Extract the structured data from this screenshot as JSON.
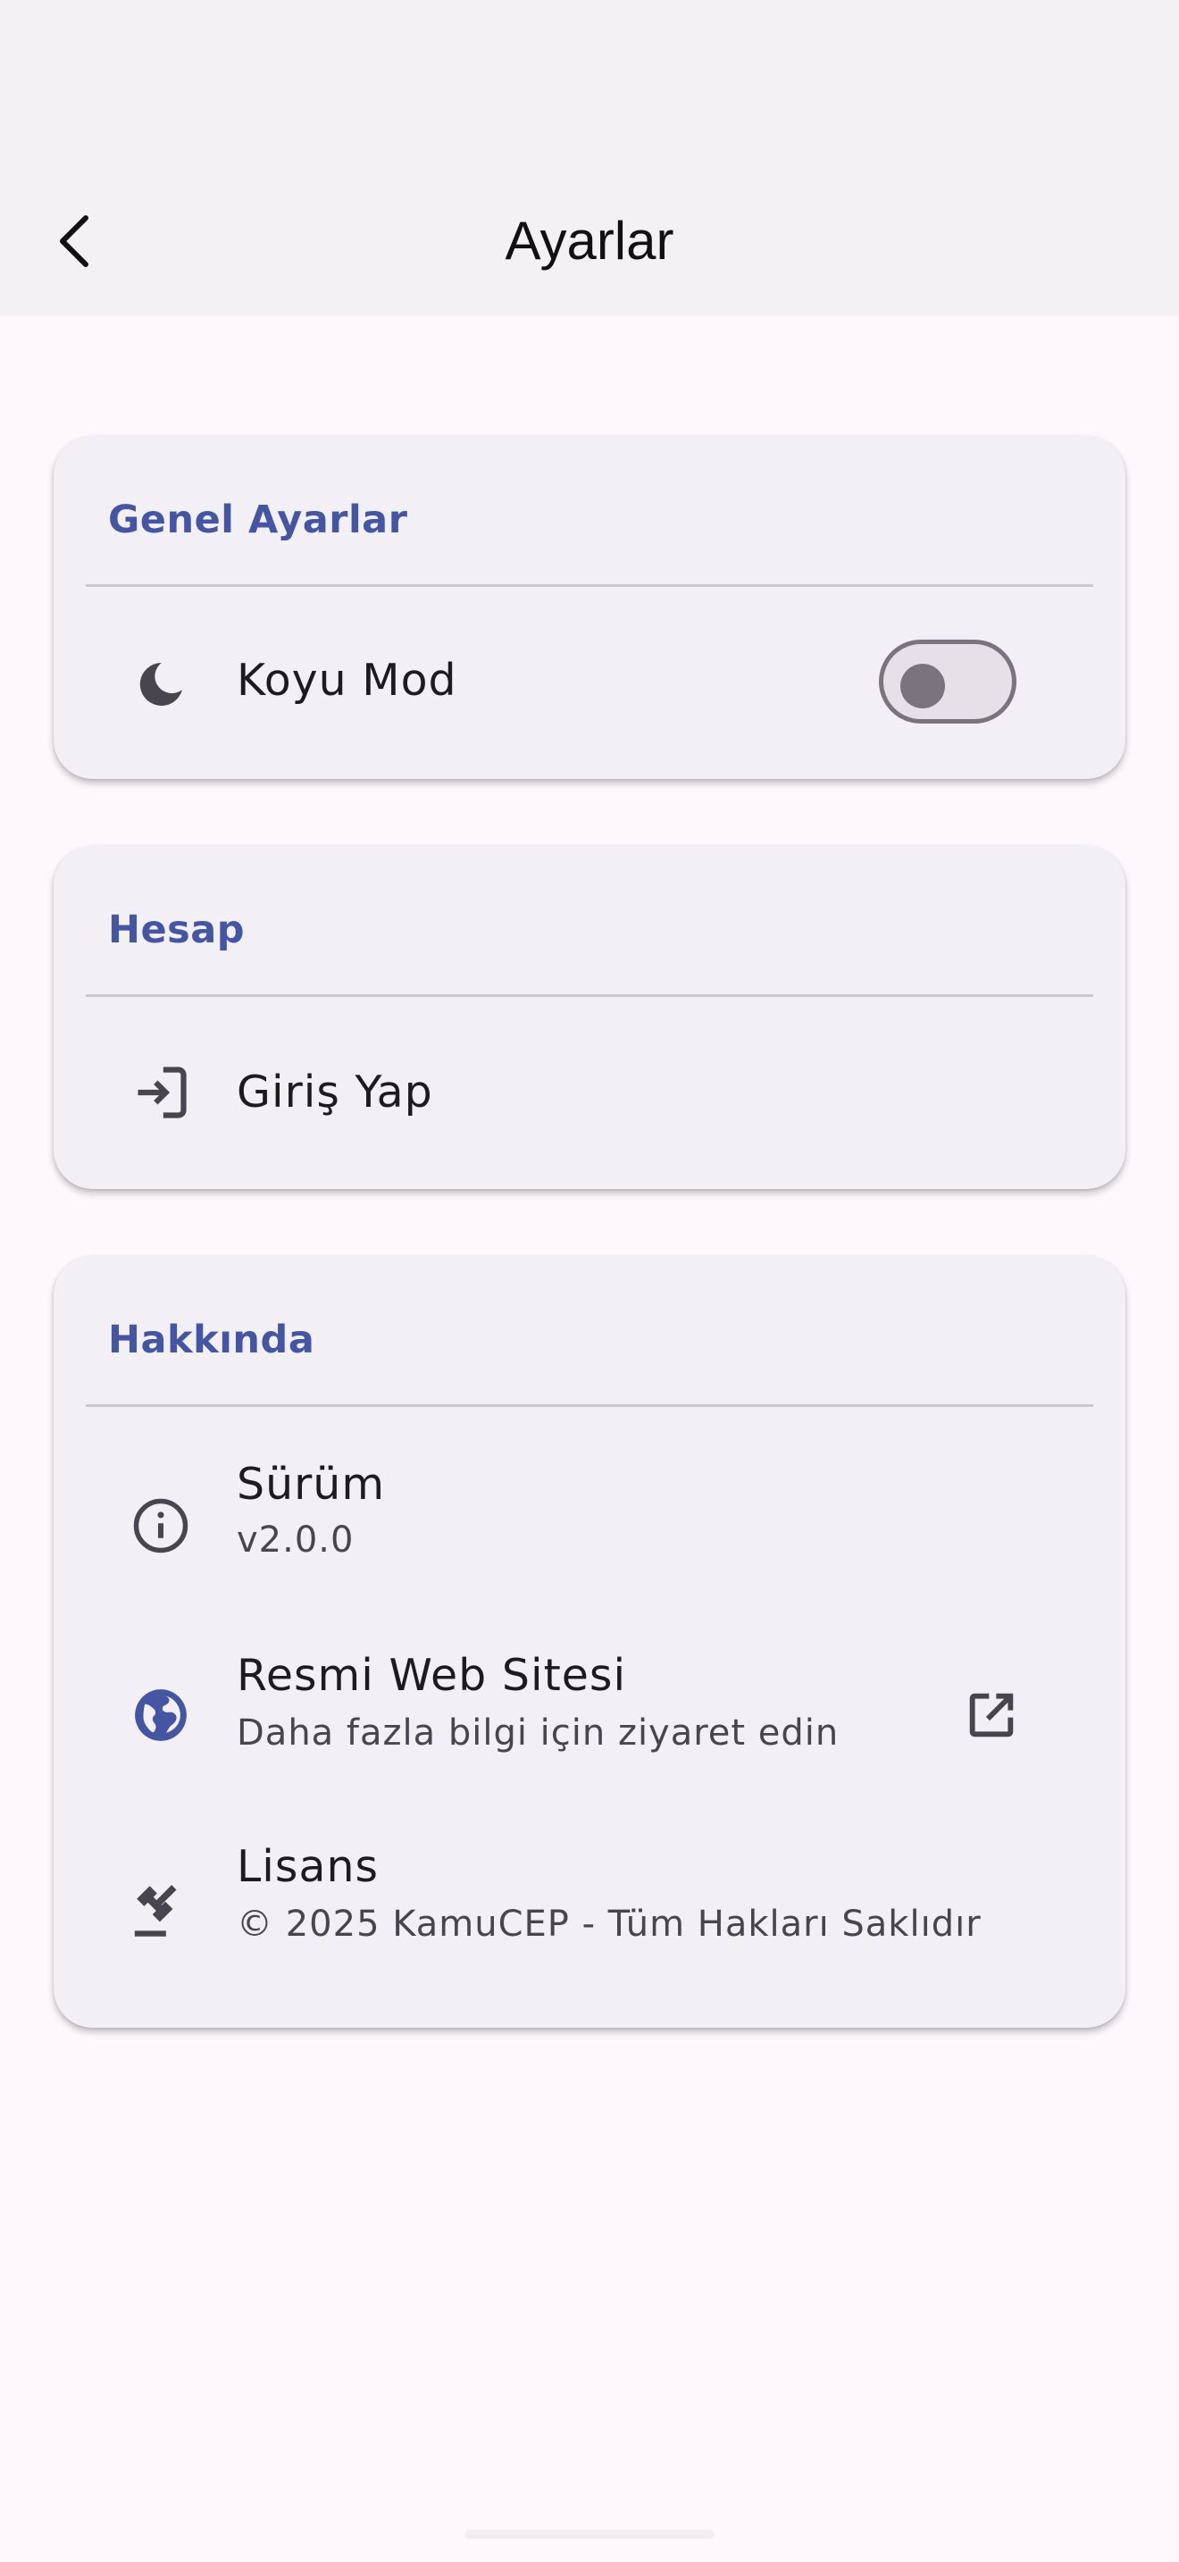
{
  "appbar": {
    "title": "Ayarlar"
  },
  "sections": {
    "general": {
      "title": "Genel Ayarlar",
      "dark_mode": {
        "label": "Koyu Mod",
        "icon": "moon-icon",
        "enabled": false
      }
    },
    "account": {
      "title": "Hesap",
      "login": {
        "label": "Giriş Yap",
        "icon": "login-icon"
      }
    },
    "about": {
      "title": "Hakkında",
      "version": {
        "label": "Sürüm",
        "value": "v2.0.0",
        "icon": "info-icon"
      },
      "website": {
        "label": "Resmi Web Sitesi",
        "subtitle": "Daha fazla bilgi için ziyaret edin",
        "icon": "globe-icon",
        "trailing_icon": "open-in-new-icon"
      },
      "license": {
        "label": "Lisans",
        "subtitle": "© 2025 KamuCEP - Tüm Hakları Saklıdır",
        "icon": "gavel-icon"
      }
    }
  },
  "colors": {
    "accent": "#4355A3",
    "background": "#FDF8FC",
    "card": "#F3F0F5",
    "appbar": "#F3F1F4"
  }
}
